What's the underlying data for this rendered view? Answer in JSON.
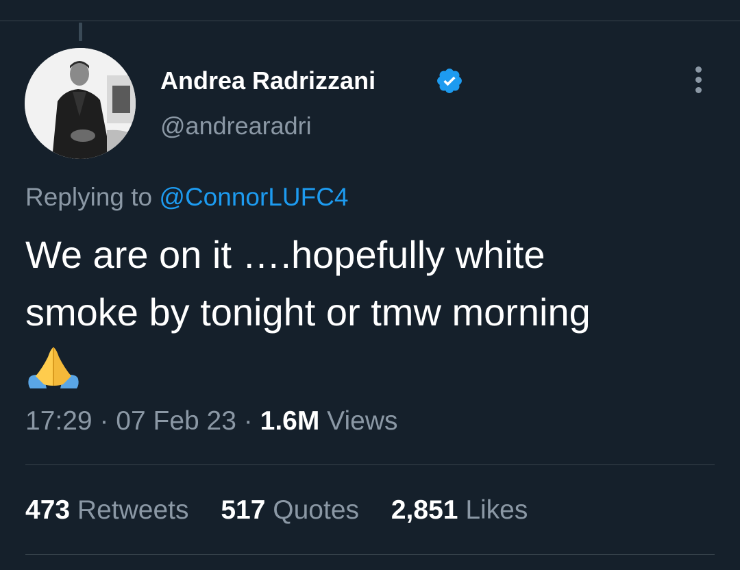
{
  "tweet": {
    "author_name": "Andrea Radrizzani",
    "handle": "@andrearadri",
    "replying_prefix": "Replying to",
    "replying_to": "@ConnorLUFC4",
    "text_line1": "We are on it ….hopefully white",
    "text_line2": "smoke by tonight or tmw morning",
    "emoji_icon": "folded-hands-icon",
    "time": "17:29",
    "date": "07 Feb 23",
    "separator": "·",
    "views_count": "1.6M",
    "views_label": "Views"
  },
  "stats": {
    "retweets_count": "473",
    "retweets_label": "Retweets",
    "quotes_count": "517",
    "quotes_label": "Quotes",
    "likes_count": "2,851",
    "likes_label": "Likes"
  },
  "colors": {
    "background": "#15202b",
    "text_primary": "#ffffff",
    "text_secondary": "#8b98a5",
    "accent": "#1d9bf0",
    "divider": "#38444d"
  }
}
